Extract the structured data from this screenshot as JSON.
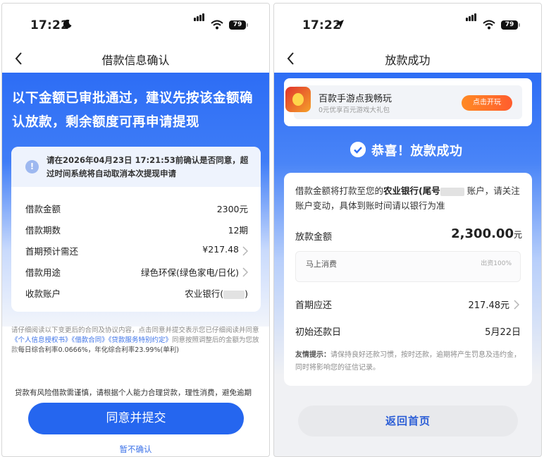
{
  "left": {
    "status": {
      "time": "17:22",
      "time_icon": "moon-icon",
      "battery": "79"
    },
    "nav": {
      "title": "借款信息确认"
    },
    "headline": "以下金额已审批通过，建议先按该金额确认放款，剩余额度可再申请提现",
    "notice": "请在2026年04月23日 17:21:53前确认是否同意，超过时间系统将自动取消本次提现申请",
    "rows": [
      {
        "label": "借款金额",
        "value": "2300元"
      },
      {
        "label": "借款期数",
        "value": "12期"
      },
      {
        "label": "首期预计需还",
        "value": "¥217.48"
      },
      {
        "label": "借款用途",
        "value": "绿色环保(绿色家电/日化)"
      },
      {
        "label": "收款账户",
        "value_prefix": "农业银行(",
        "value_suffix": ")"
      }
    ],
    "terms": {
      "text1": "请仔细阅读以下变更后的合同及协议内容，点击同意并提交表示您已仔细阅读并同意",
      "link1": "《个人信息授权书》",
      "link2": "《借款合同》",
      "link3": "《贷款服务特别约定》",
      "text2": "同意按照调整后的金额为您放款",
      "rate": "每日综合利率0.0666%，年化综合利率23.99%(单利)"
    },
    "risk": "贷款有风险借款需谨慎，请根据个人能力合理贷款，理性消费，避免逾期",
    "submit_label": "同意并提交",
    "later_label": "暂不确认"
  },
  "right": {
    "status": {
      "time": "17:22",
      "time_icon": "location-arrow-icon",
      "battery": "79"
    },
    "nav": {
      "title": "放款成功"
    },
    "ad": {
      "title": "百款手游点我畅玩",
      "subtitle": "0元优享百元游戏大礼包",
      "button": "点击开玩"
    },
    "success": "恭喜！放款成功",
    "desc": {
      "text1": "借款金额将打款至您的",
      "bank": "农业银行(尾号",
      "text2": "账户，请关注账户变动，具体到账时间请以银行为准"
    },
    "amount": {
      "label": "放款金额",
      "value": "2,300.00",
      "unit": "元"
    },
    "sub": {
      "label": "马上消费",
      "note": "出资100%"
    },
    "first_pay": {
      "label": "首期应还",
      "value": "217.48元"
    },
    "start_date": {
      "label": "初始还款日",
      "value": "5月22日"
    },
    "tip": {
      "label": "友情提示：",
      "text": "请保持良好还款习惯，按时还款，逾期将产生罚息及违约金，同时将影响您的征信记录。"
    },
    "home_label": "返回首页"
  },
  "colors": {
    "primary": "#2566ef",
    "link": "#3d73e8",
    "orange": "#ff6b2b"
  }
}
